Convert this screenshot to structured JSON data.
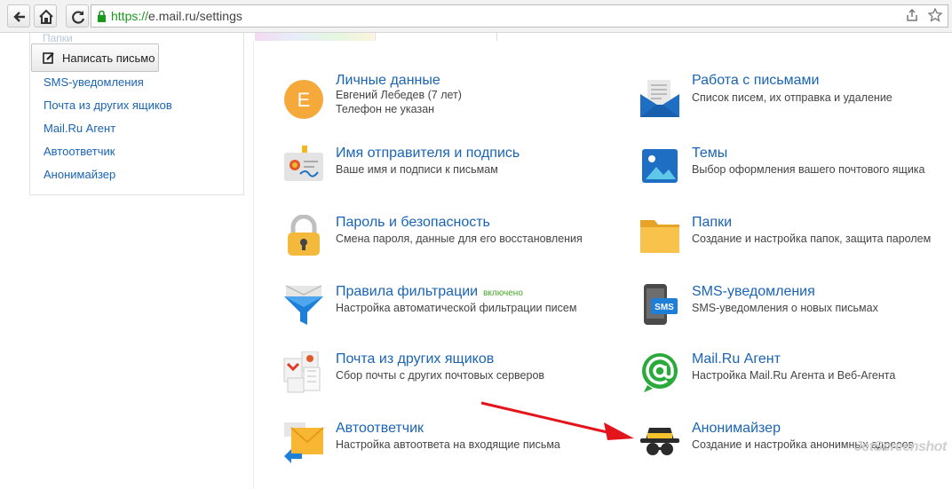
{
  "browser": {
    "url_scheme": "https://",
    "url_rest": "e.mail.ru/settings"
  },
  "left": {
    "faded_folder": "Папки",
    "compose_label": "Написать письмо",
    "links": [
      "SMS-уведомления",
      "Почта из других ящиков",
      "Mail.Ru Агент",
      "Автоответчик",
      "Анонимайзер"
    ]
  },
  "settings": [
    {
      "title": "Личные данные",
      "desc": "Евгений Лебедев  (7 лет)",
      "desc2": "Телефон не указан",
      "icon": "avatar-icon"
    },
    {
      "title": "Работа с письмами",
      "desc": "Список писем, их отправка и удаление",
      "icon": "mail-work-icon"
    },
    {
      "title": "Имя отправителя и подпись",
      "desc": "Ваше имя и подписи к письмам",
      "icon": "signature-icon"
    },
    {
      "title": "Темы",
      "desc": "Выбор оформления вашего почтового ящика",
      "icon": "themes-icon"
    },
    {
      "title": "Пароль и безопасность",
      "desc": "Смена пароля, данные для его восстановления",
      "icon": "lock-icon"
    },
    {
      "title": "Папки",
      "desc": "Создание и настройка папок, защита паролем",
      "icon": "folder-icon"
    },
    {
      "title": "Правила фильтрации",
      "badge": "включено",
      "desc": "Настройка автоматической фильтрации писем",
      "icon": "filter-icon"
    },
    {
      "title": "SMS-уведомления",
      "desc": "SMS-уведомления о новых письмах",
      "icon": "sms-icon"
    },
    {
      "title": "Почта из других ящиков",
      "desc": "Сбор почты с других почтовых серверов",
      "icon": "collector-icon"
    },
    {
      "title": "Mail.Ru Агент",
      "desc": "Настройка Mail.Ru Агента и Веб-Агента",
      "icon": "agent-icon"
    },
    {
      "title": "Автоответчик",
      "desc": "Настройка автоответа на входящие письма",
      "icon": "autoreply-icon"
    },
    {
      "title": "Анонимайзер",
      "desc": "Создание и настройка анонимных адресов",
      "icon": "anonymizer-icon"
    }
  ],
  "avatar_letter": "E",
  "sms_badge": "SMS",
  "watermark": "JetScreenshot",
  "colors": {
    "link": "#1a64b4",
    "badge": "#46a827",
    "arrow": "#e3141b"
  }
}
